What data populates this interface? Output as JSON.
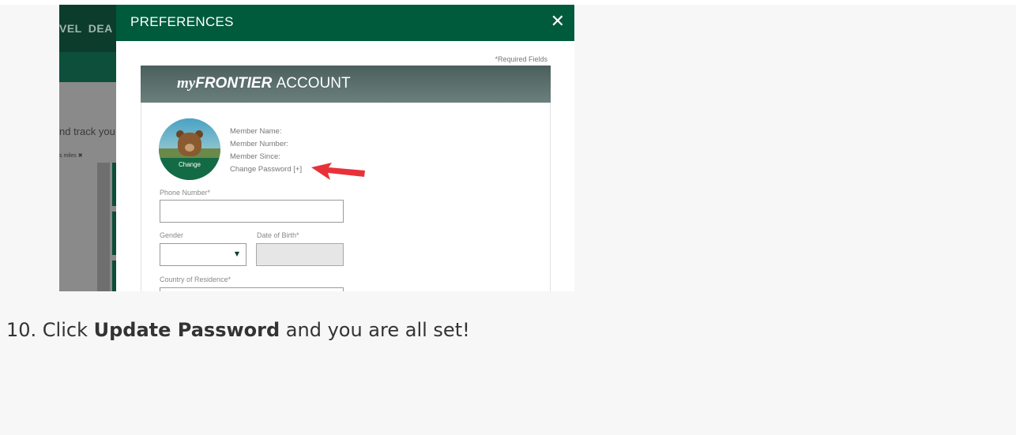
{
  "background_page": {
    "nav_items": [
      "VEL",
      "DEA"
    ],
    "body_text": "nd track you",
    "small_text": "s miles ✖"
  },
  "modal": {
    "title": "PREFERENCES",
    "close_icon": "close-icon",
    "required_note": "*Required Fields",
    "account_banner": {
      "my": "my",
      "frontier": "FRONTIER",
      "account": "ACCOUNT"
    },
    "avatar": {
      "change_label": "Change",
      "icon": "bear-avatar"
    },
    "member": {
      "name_label": "Member Name:",
      "number_label": "Member Number:",
      "since_label": "Member Since:",
      "change_password": "Change Password [+]"
    },
    "annotation": {
      "icon": "red-arrow-icon",
      "color": "#e8323a"
    },
    "fields": {
      "phone_label": "Phone Number*",
      "gender_label": "Gender",
      "dob_label": "Date of Birth*",
      "country_label": "Country of Residence*"
    }
  },
  "caption": {
    "prefix": "10. Click ",
    "bold": "Update Password",
    "suffix": " and you are all set!"
  },
  "colors": {
    "header_green": "#005a3c",
    "banner_gray": "#5b6f6d",
    "accent_red": "#e8323a"
  }
}
